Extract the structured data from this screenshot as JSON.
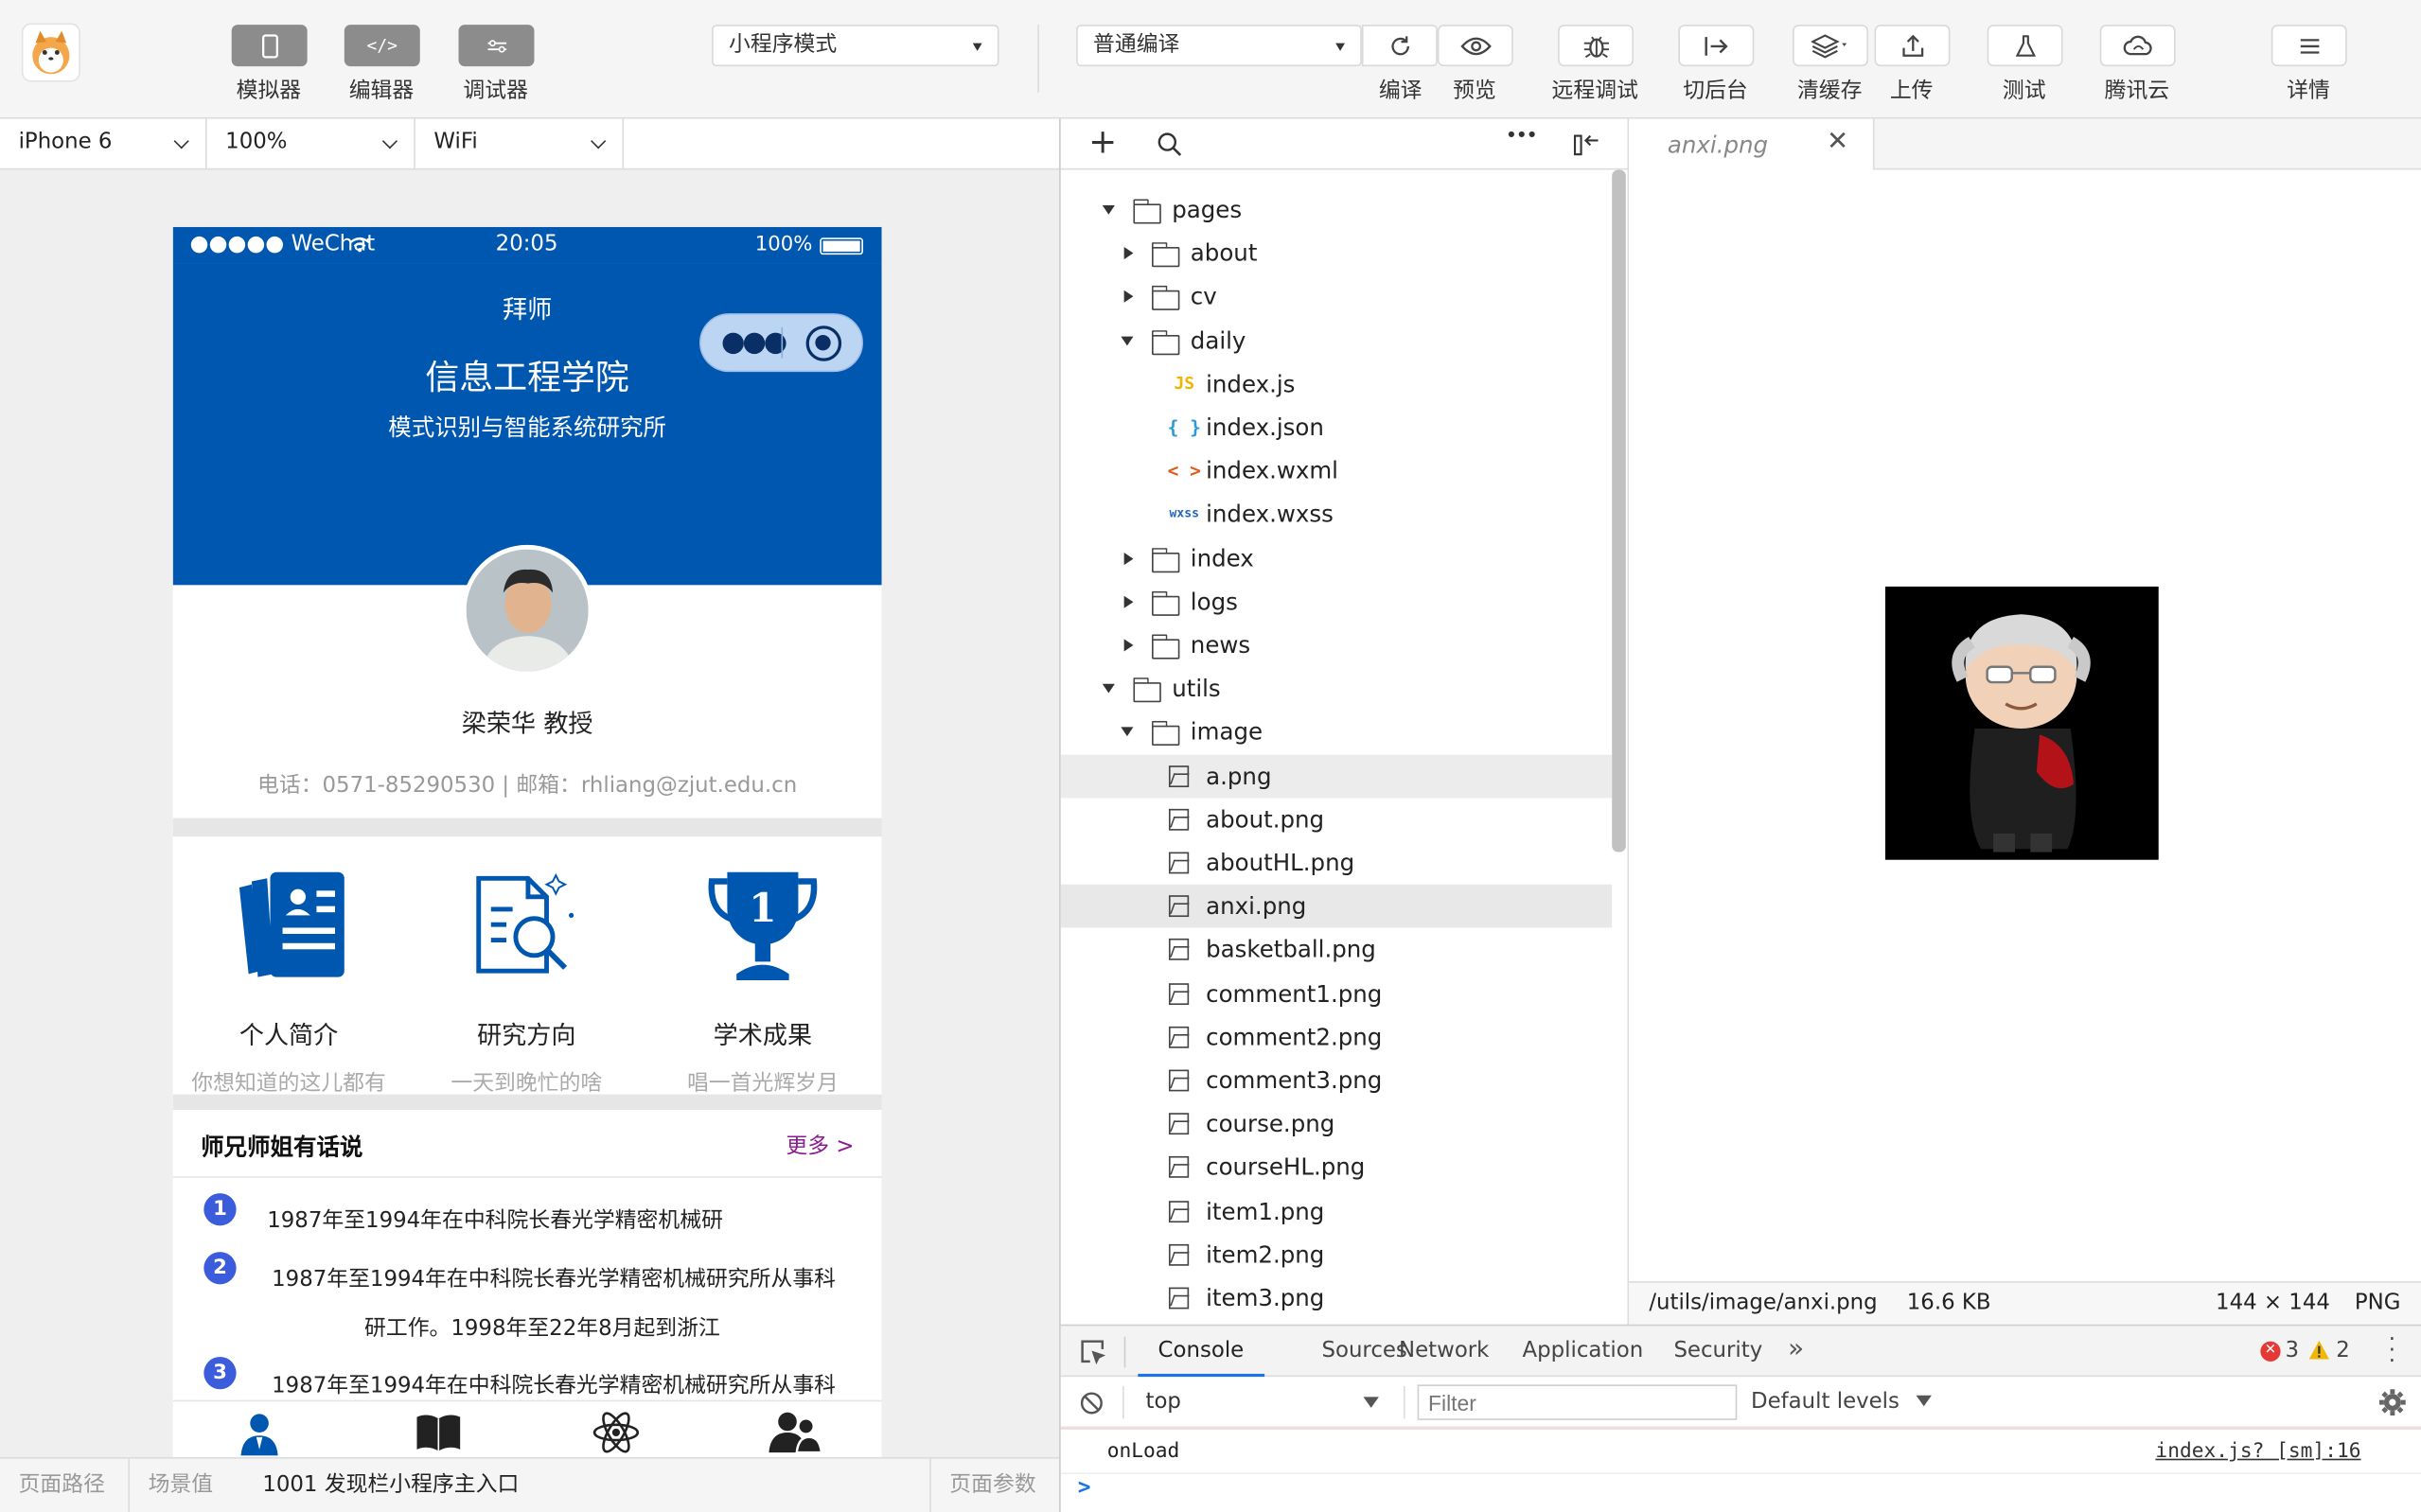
{
  "toolbar": {
    "simulator_label": "模拟器",
    "editor_label": "编辑器",
    "debugger_label": "调试器",
    "mode_select": "小程序模式",
    "compile_select": "普通编译",
    "compile_label": "编译",
    "preview_label": "预览",
    "remote_debug_label": "远程调试",
    "background_label": "切后台",
    "clear_cache_label": "清缓存",
    "upload_label": "上传",
    "test_label": "测试",
    "tencent_cloud_label": "腾讯云",
    "details_label": "详情"
  },
  "subbar": {
    "device": "iPhone 6",
    "zoom": "100%",
    "network": "WiFi"
  },
  "phone": {
    "carrier": "●●●●● WeChat",
    "time": "20:05",
    "battery": "100%",
    "nav_title": "拜师",
    "header_title": "信息工程学院",
    "header_subtitle": "模式识别与智能系统研究所",
    "name": "梁荣华 教授",
    "contact": "电话：0571-85290530 | 邮箱：rhliang@zjut.edu.cn",
    "cards": [
      {
        "title": "个人简介",
        "desc": "你想知道的这儿都有"
      },
      {
        "title": "研究方向",
        "desc": "一天到晚忙的啥"
      },
      {
        "title": "学术成果",
        "desc": "唱一首光辉岁月"
      }
    ],
    "section_title": "师兄师姐有话说",
    "section_more": "更多 >",
    "notices": [
      {
        "num": "1",
        "line1": "1987年至1994年在中科院长春光学精密机械研",
        "line2": ""
      },
      {
        "num": "2",
        "line1": "1987年至1994年在中科院长春光学精密机械研究所从事科",
        "line2": "研工作。1998年至22年8月起到浙江"
      },
      {
        "num": "3",
        "line1": "1987年至1994年在中科院长春光学精密机械研究所从事科",
        "line2": ""
      }
    ]
  },
  "bottombar": {
    "page_path": "页面路径",
    "scene_label": "场景值",
    "scene_value": "1001 发现栏小程序主入口",
    "page_params": "页面参数"
  },
  "tree": {
    "rows": [
      {
        "name": "pages",
        "kind": "folder-open",
        "depth": 0
      },
      {
        "name": "about",
        "kind": "folder",
        "depth": 1
      },
      {
        "name": "cv",
        "kind": "folder",
        "depth": 1
      },
      {
        "name": "daily",
        "kind": "folder-open",
        "depth": 1
      },
      {
        "name": "index.js",
        "kind": "js",
        "depth": 2
      },
      {
        "name": "index.json",
        "kind": "json",
        "depth": 2
      },
      {
        "name": "index.wxml",
        "kind": "wxml",
        "depth": 2
      },
      {
        "name": "index.wxss",
        "kind": "wxss",
        "depth": 2
      },
      {
        "name": "index",
        "kind": "folder",
        "depth": 1
      },
      {
        "name": "logs",
        "kind": "folder",
        "depth": 1
      },
      {
        "name": "news",
        "kind": "folder",
        "depth": 1
      },
      {
        "name": "utils",
        "kind": "folder-open",
        "depth": 0
      },
      {
        "name": "image",
        "kind": "folder-open",
        "depth": 1
      },
      {
        "name": "a.png",
        "kind": "image",
        "depth": 2,
        "state": "hover"
      },
      {
        "name": "about.png",
        "kind": "image",
        "depth": 2
      },
      {
        "name": "aboutHL.png",
        "kind": "image",
        "depth": 2
      },
      {
        "name": "anxi.png",
        "kind": "image",
        "depth": 2,
        "state": "selected"
      },
      {
        "name": "basketball.png",
        "kind": "image",
        "depth": 2
      },
      {
        "name": "comment1.png",
        "kind": "image",
        "depth": 2
      },
      {
        "name": "comment2.png",
        "kind": "image",
        "depth": 2
      },
      {
        "name": "comment3.png",
        "kind": "image",
        "depth": 2
      },
      {
        "name": "course.png",
        "kind": "image",
        "depth": 2
      },
      {
        "name": "courseHL.png",
        "kind": "image",
        "depth": 2
      },
      {
        "name": "item1.png",
        "kind": "image",
        "depth": 2
      },
      {
        "name": "item2.png",
        "kind": "image",
        "depth": 2
      },
      {
        "name": "item3.png",
        "kind": "image",
        "depth": 2
      }
    ]
  },
  "editor": {
    "tab_name": "anxi.png",
    "image_path": "/utils/image/anxi.png",
    "image_size": "16.6 KB",
    "image_dims": "144 × 144",
    "image_format": "PNG"
  },
  "devtools": {
    "tabs": [
      "Console",
      "Sources",
      "Network",
      "Application",
      "Security"
    ],
    "active_tab": "Console",
    "error_count": "3",
    "warning_count": "2",
    "context": "top",
    "filter_placeholder": "Filter",
    "levels": "Default levels",
    "log_message": "onLoad",
    "log_source": "index.js? [sm]:16",
    "prompt": ">"
  },
  "colors": {
    "brand_blue": "#0057b0",
    "badge_blue": "#3b5ddc",
    "more_purple": "#8a1c8f",
    "error_red": "#e53935",
    "warning_yellow": "#f2b705"
  }
}
